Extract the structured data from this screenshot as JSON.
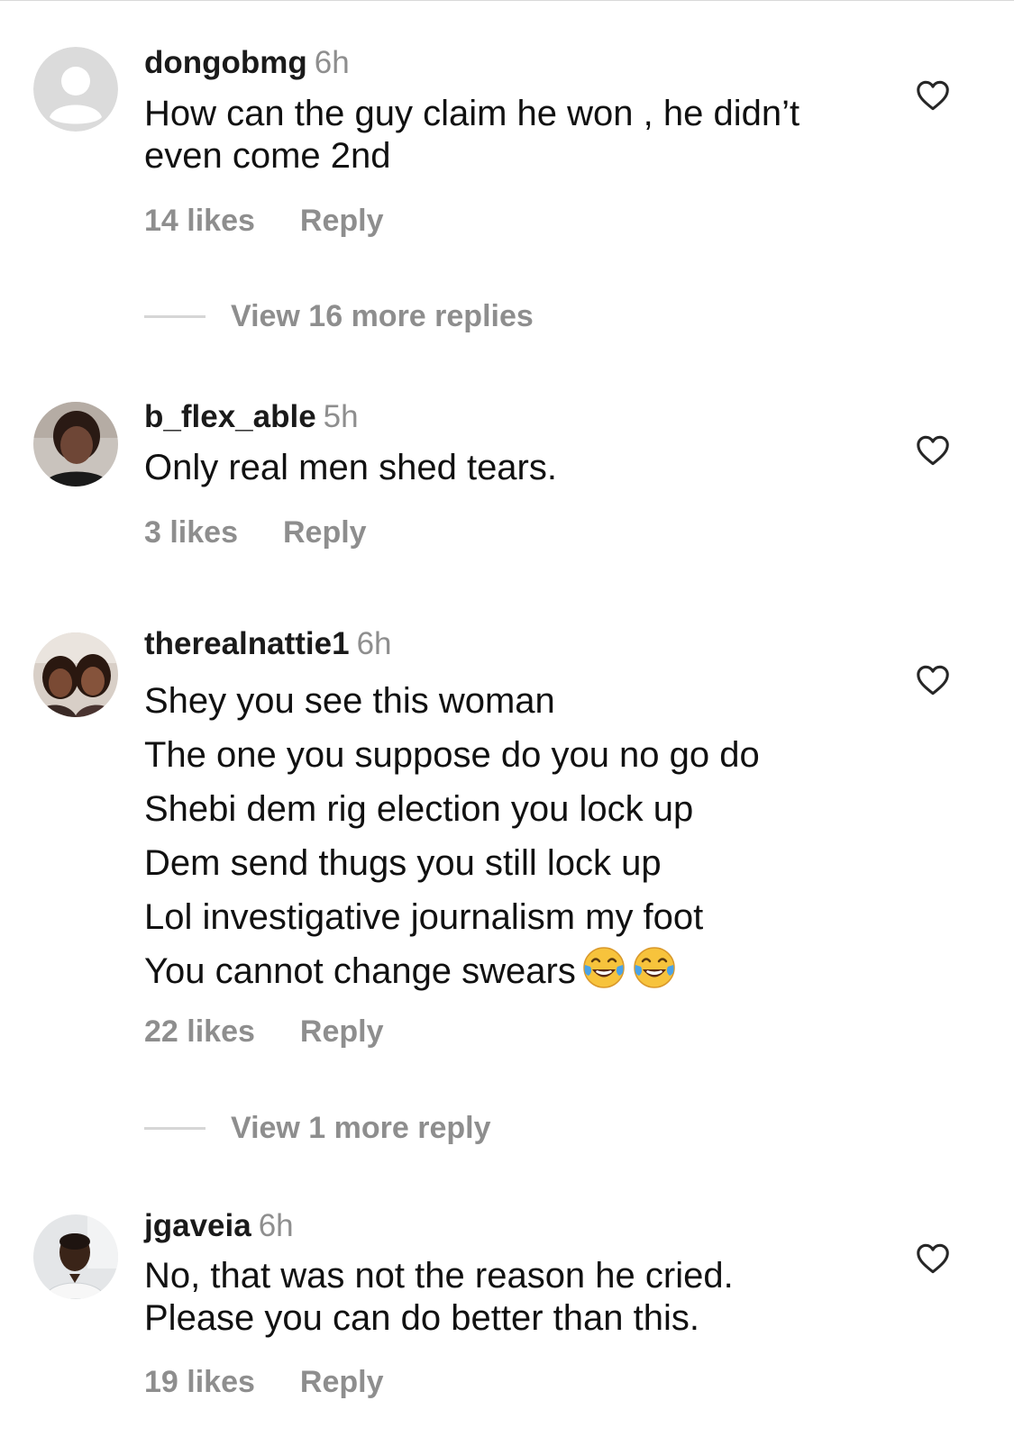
{
  "comments": [
    {
      "username": "dongobmg",
      "time": "6h",
      "avatar": "default-avatar",
      "lines": [
        "How can the guy claim he won , he didn’t",
        "even come 2nd"
      ],
      "likes": "14 likes",
      "reply": "Reply",
      "view_more": "View 16 more replies"
    },
    {
      "username": "b_flex_able",
      "time": "5h",
      "avatar": "photo-avatar",
      "lines": [
        "Only real men shed tears."
      ],
      "likes": "3 likes",
      "reply": "Reply"
    },
    {
      "username": "therealnattie1",
      "time": "6h",
      "avatar": "photo-avatar",
      "lines": [
        "Shey you see this woman",
        "The one you suppose do you no go do",
        "Shebi dem rig election you lock up",
        "Dem send thugs you still lock up",
        "Lol investigative journalism my foot",
        "You cannot change swears"
      ],
      "emoji": "😂😂",
      "likes": "22 likes",
      "reply": "Reply",
      "view_more": "View 1 more reply"
    },
    {
      "username": "jgaveia",
      "time": "6h",
      "avatar": "photo-avatar",
      "lines": [
        "No, that was not the reason he cried.",
        "Please you can do better than this."
      ],
      "likes": "19 likes",
      "reply": "Reply"
    }
  ],
  "colors": {
    "secondary_text": "#8e8e8e",
    "primary_text": "#111111",
    "divider": "#d6d6d6"
  },
  "icons": {
    "like": "heart-outline-icon",
    "laugh": "face-with-tears-of-joy-emoji"
  }
}
